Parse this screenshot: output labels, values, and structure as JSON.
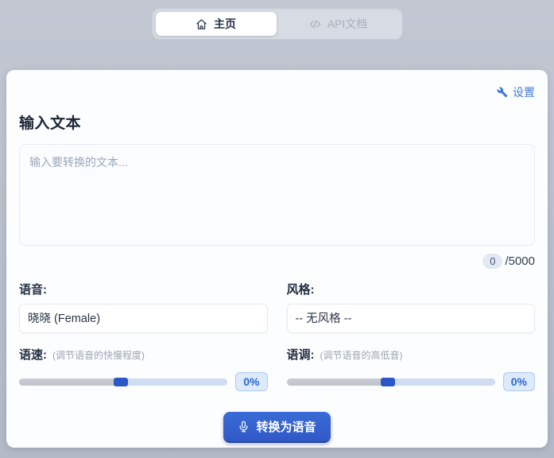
{
  "tabs": {
    "home": {
      "label": "主页"
    },
    "api": {
      "label": "API文档"
    }
  },
  "header": {
    "settings_label": "设置"
  },
  "main": {
    "title": "输入文本",
    "textarea_placeholder": "输入要转换的文本...",
    "char_count": "0",
    "char_limit": "/5000",
    "voice": {
      "label": "语音:",
      "value": "晓晓 (Female)"
    },
    "style": {
      "label": "风格:",
      "value": "-- 无风格 --"
    },
    "rate": {
      "label": "语速:",
      "hint": "(调节语音的快慢程度)",
      "value": "0%"
    },
    "pitch": {
      "label": "语调:",
      "hint": "(调节语音的高低音)",
      "value": "0%"
    },
    "convert_label": "转换为语音"
  },
  "colors": {
    "accent_blue": "#3565d0",
    "link_blue": "#4679d2",
    "badge_blue": "#2a66d4",
    "page_background": "#b9bfcc",
    "panel_background": "#fcfdfe"
  },
  "icons": {
    "home": "home-icon",
    "code": "code-icon",
    "wrench": "wrench-icon",
    "microphone": "microphone-icon"
  }
}
